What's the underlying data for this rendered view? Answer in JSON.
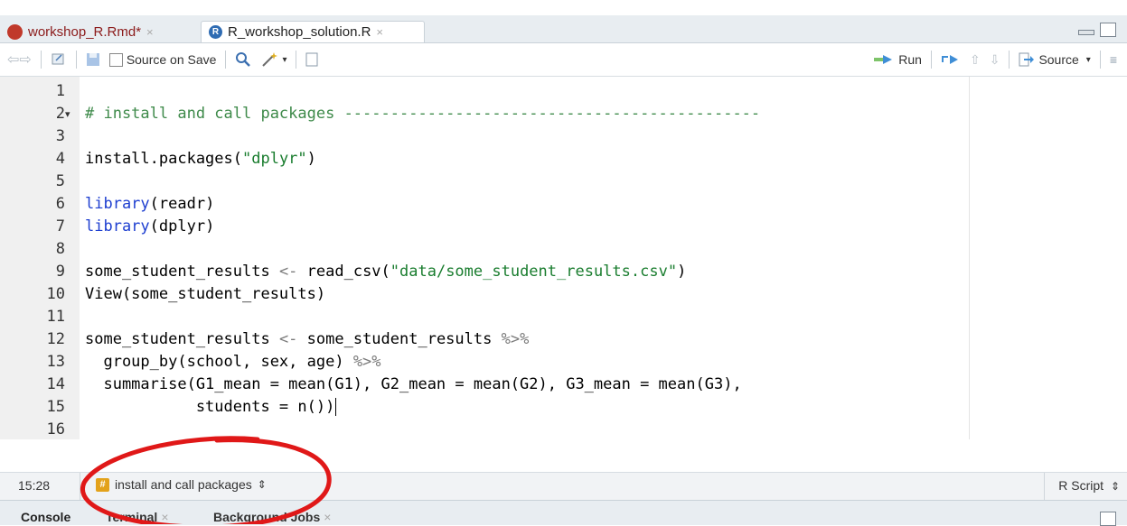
{
  "tabs": [
    {
      "label": "workshop_R.Rmd*",
      "close": "×"
    },
    {
      "label": "R_workshop_solution.R",
      "close": "×"
    }
  ],
  "toolbar": {
    "source_on_save": "Source on Save",
    "run": "Run",
    "source": "Source"
  },
  "editor": {
    "line_numbers": [
      "1",
      "2",
      "3",
      "4",
      "5",
      "6",
      "7",
      "8",
      "9",
      "10",
      "11",
      "12",
      "13",
      "14",
      "15",
      "16"
    ],
    "lines": {
      "l2_comment": "# install and call packages ---------------------------------------------",
      "l4_fn": "install.packages(",
      "l4_str": "\"dplyr\"",
      "l4_end": ")",
      "l6_kw": "library",
      "l6_rest": "(readr)",
      "l7_kw": "library",
      "l7_rest": "(dplyr)",
      "l9_a": "some_student_results ",
      "l9_op": "<-",
      "l9_b": " read_csv(",
      "l9_str": "\"data/some_student_results.csv\"",
      "l9_c": ")",
      "l10": "View(some_student_results)",
      "l12_a": "some_student_results ",
      "l12_op": "<-",
      "l12_b": " some_student_results ",
      "l12_pipe": "%>%",
      "l13_a": "  group_by(school, sex, age) ",
      "l13_pipe": "%>%",
      "l14": "  summarise(G1_mean = mean(G1), G2_mean = mean(G2), G3_mean = mean(G3),",
      "l15": "            students = n())"
    }
  },
  "status": {
    "position": "15:28",
    "section": "install and call packages",
    "section_arrow": "⇕",
    "file_type": "R Script",
    "file_type_arrow": "⇕"
  },
  "console_tabs": [
    {
      "label": "Console"
    },
    {
      "label": "Terminal",
      "close": "×"
    },
    {
      "label": "Background Jobs",
      "close": "×"
    }
  ],
  "colors": {
    "comment": "#3e8a4a",
    "keyword": "#1d3ed0",
    "string": "#1a7d2f",
    "annotation": "#e01818"
  }
}
